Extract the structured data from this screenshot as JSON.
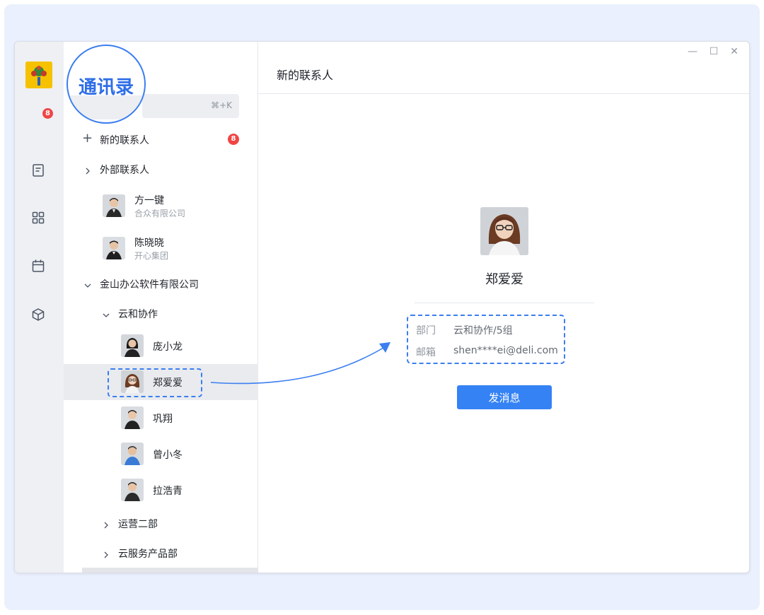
{
  "callout": {
    "text": "通讯录"
  },
  "rail": {
    "badge_count": "8",
    "icons": [
      "docs-icon",
      "apps-grid-icon",
      "calendar-icon",
      "cube-icon"
    ]
  },
  "search": {
    "shortcut": "⌘+K"
  },
  "contacts": {
    "new_contacts": {
      "label": "新的联系人",
      "badge": "8"
    },
    "external_group": {
      "label": "外部联系人"
    },
    "external_members": [
      {
        "name": "方一键",
        "company": "合众有限公司"
      },
      {
        "name": "陈晓晓",
        "company": "开心集团"
      }
    ],
    "org": {
      "label": "金山办公软件有限公司"
    },
    "dept": {
      "label": "云和协作"
    },
    "dept_members": [
      {
        "name": "庞小龙"
      },
      {
        "name": "郑爱爱"
      },
      {
        "name": "巩翔"
      },
      {
        "name": "曾小冬"
      },
      {
        "name": "拉浩青"
      }
    ],
    "other_depts": [
      {
        "label": "运营二部"
      },
      {
        "label": "云服务产品部"
      }
    ]
  },
  "detail": {
    "title": "新的联系人",
    "window_controls": {
      "minimize": "—",
      "maximize": "☐",
      "close": "✕"
    },
    "profile": {
      "name": "郑爱爱",
      "dept_label": "部门",
      "dept_value": "云和协作/5组",
      "email_label": "邮箱",
      "email_value": "shen****ei@deli.com"
    },
    "send_button": "发消息"
  },
  "colors": {
    "accent": "#3582f5",
    "badge": "#f04545",
    "highlight": "#3b7ef0",
    "backdrop": "#eaf0fd"
  }
}
